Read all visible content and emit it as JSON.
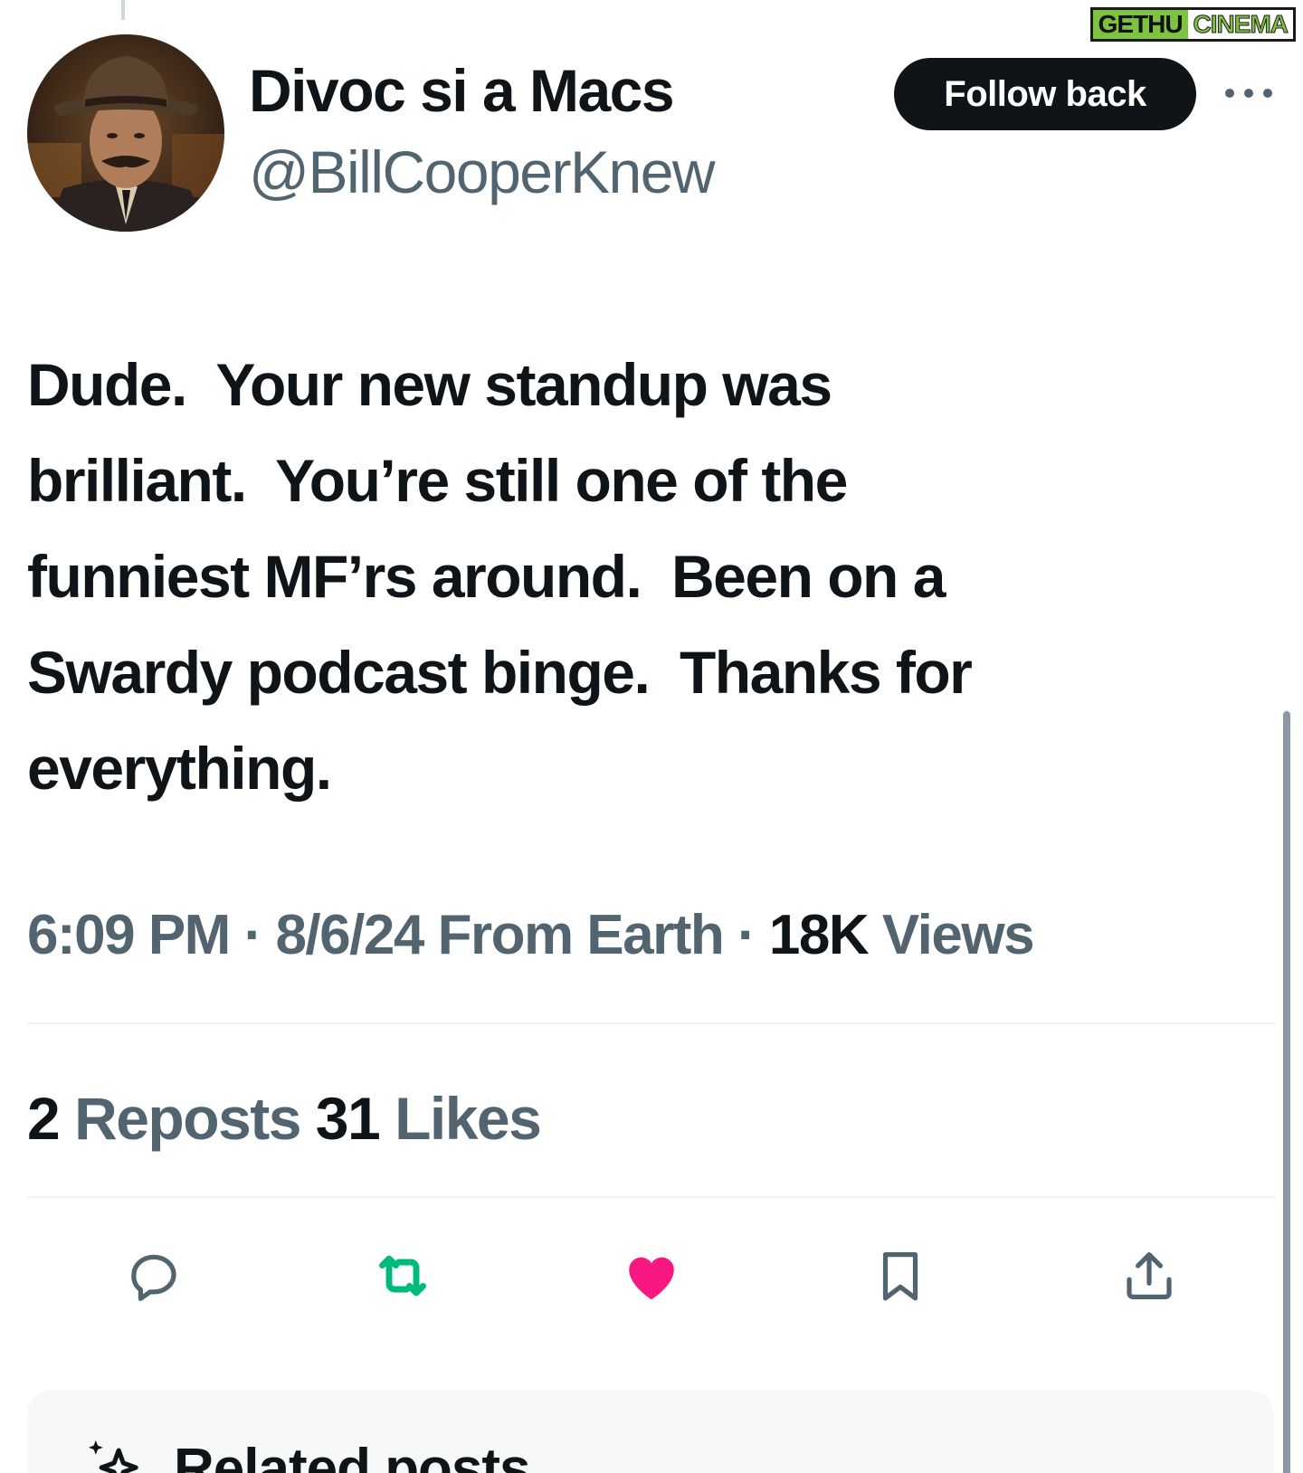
{
  "watermark": {
    "part_a": "GETHU",
    "part_b": "CINEMA"
  },
  "author": {
    "display_name": "Divoc si a Macs",
    "handle": "@BillCooperKnew"
  },
  "header": {
    "follow_label": "Follow back",
    "more_icon": "more-horizontal-icon"
  },
  "tweet": {
    "text": "Dude.  Your new standup was\nbrilliant.  You’re still one of the\nfunniest MF’rs around.  Been on a\nSwardy podcast binge.  Thanks for\neverything."
  },
  "meta": {
    "time": "6:09 PM",
    "separator": "·",
    "date": "8/6/24",
    "source": "From Earth",
    "views_count": "18K",
    "views_label": "Views"
  },
  "stats": {
    "reposts_count": "2",
    "reposts_label": "Reposts",
    "likes_count": "31",
    "likes_label": "Likes"
  },
  "actions": {
    "reply_icon": "reply-icon",
    "repost_icon": "repost-icon",
    "like_icon": "like-icon",
    "bookmark_icon": "bookmark-icon",
    "share_icon": "share-icon"
  },
  "related": {
    "title": "Related posts",
    "icon": "sparkle-icon"
  },
  "colors": {
    "text": "#0f1419",
    "secondary": "#536471",
    "repost_active": "#00ba7c",
    "like_active": "#f91880",
    "follow_bg": "#0f1419",
    "divider": "#eff3f4"
  }
}
